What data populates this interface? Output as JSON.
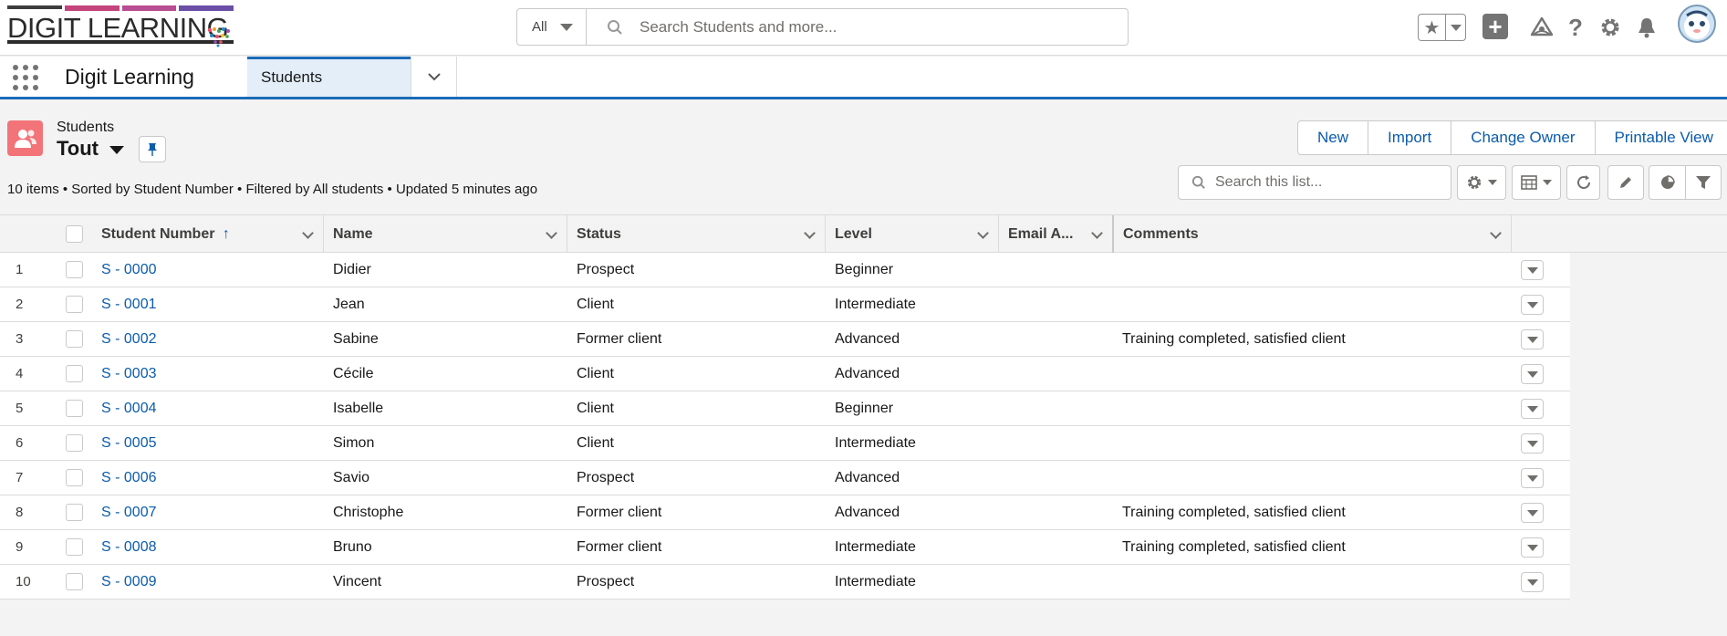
{
  "brand": {
    "logo_text": "DIGIT LEARNING",
    "stripe_colors": [
      "#3d3d3d",
      "#c4447e",
      "#b84d94",
      "#6b4fa7"
    ]
  },
  "global_search": {
    "scope": "All",
    "placeholder": "Search Students and more..."
  },
  "app_nav": {
    "app_name": "Digit Learning",
    "tab_label": "Students"
  },
  "list_header": {
    "object_label": "Students",
    "view_name": "Tout",
    "actions": [
      "New",
      "Import",
      "Change Owner",
      "Printable View"
    ],
    "info": "10 items • Sorted by Student Number • Filtered by All students • Updated 5 minutes ago",
    "search_placeholder": "Search this list..."
  },
  "table": {
    "columns": [
      "Student Number",
      "Name",
      "Status",
      "Level",
      "Email A...",
      "Comments"
    ],
    "sort_indicator": "↑",
    "rows": [
      {
        "n": "1",
        "number": "S - 0000",
        "name": "Didier",
        "status": "Prospect",
        "level": "Beginner",
        "email": "",
        "comments": ""
      },
      {
        "n": "2",
        "number": "S - 0001",
        "name": "Jean",
        "status": "Client",
        "level": "Intermediate",
        "email": "",
        "comments": ""
      },
      {
        "n": "3",
        "number": "S - 0002",
        "name": "Sabine",
        "status": "Former client",
        "level": "Advanced",
        "email": "",
        "comments": "Training completed, satisfied client"
      },
      {
        "n": "4",
        "number": "S - 0003",
        "name": "Cécile",
        "status": "Client",
        "level": "Advanced",
        "email": "",
        "comments": ""
      },
      {
        "n": "5",
        "number": "S - 0004",
        "name": "Isabelle",
        "status": "Client",
        "level": "Beginner",
        "email": "",
        "comments": ""
      },
      {
        "n": "6",
        "number": "S - 0005",
        "name": "Simon",
        "status": "Client",
        "level": "Intermediate",
        "email": "",
        "comments": ""
      },
      {
        "n": "7",
        "number": "S - 0006",
        "name": "Savio",
        "status": "Prospect",
        "level": "Advanced",
        "email": "",
        "comments": ""
      },
      {
        "n": "8",
        "number": "S - 0007",
        "name": "Christophe",
        "status": "Former client",
        "level": "Advanced",
        "email": "",
        "comments": "Training completed, satisfied client"
      },
      {
        "n": "9",
        "number": "S - 0008",
        "name": "Bruno",
        "status": "Former client",
        "level": "Intermediate",
        "email": "",
        "comments": "Training completed, satisfied client"
      },
      {
        "n": "10",
        "number": "S - 0009",
        "name": "Vincent",
        "status": "Prospect",
        "level": "Intermediate",
        "email": "",
        "comments": ""
      }
    ]
  },
  "colors": {
    "accent": "#1b6bb8",
    "link": "#0b5cab",
    "object_icon": "#f27479",
    "active_tab_bg": "#e3eef9"
  }
}
